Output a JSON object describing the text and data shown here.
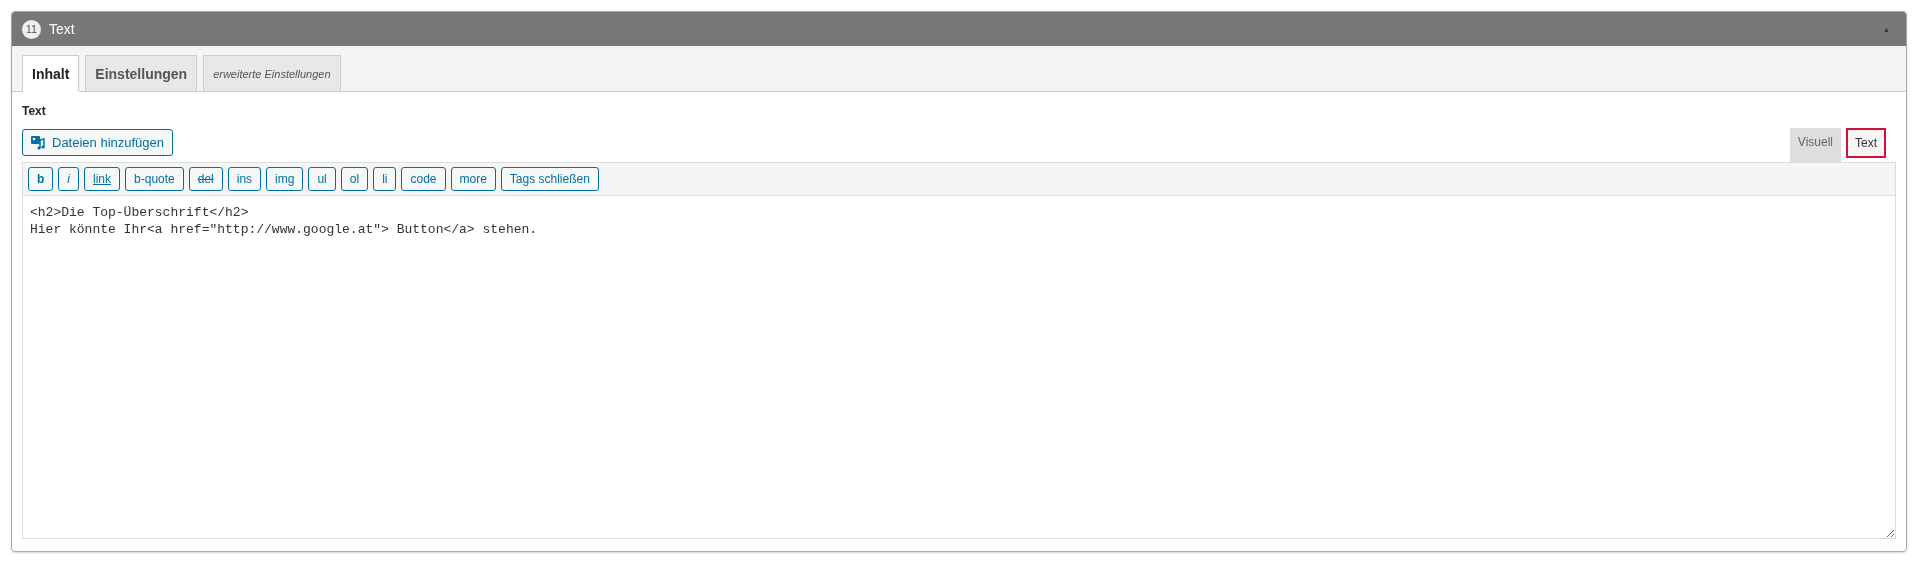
{
  "panel": {
    "number": "11",
    "title": "Text",
    "collapse_icon": "▲"
  },
  "tabs": [
    {
      "label": "Inhalt",
      "selected": true,
      "kind": "normal"
    },
    {
      "label": "Einstellungen",
      "selected": false,
      "kind": "normal"
    },
    {
      "label": "erweiterte Einstellungen",
      "selected": false,
      "kind": "italic"
    }
  ],
  "field_label": "Text",
  "add_media_button": "Dateien hinzufügen",
  "editor_tabs": [
    {
      "label": "Visuell",
      "selected": false,
      "highlighted": false
    },
    {
      "label": "Text",
      "selected": true,
      "highlighted": true
    }
  ],
  "toolbar": [
    {
      "label": "b",
      "kind": "bold"
    },
    {
      "label": "i",
      "kind": "italic"
    },
    {
      "label": "link",
      "kind": "underline"
    },
    {
      "label": "b-quote",
      "kind": "plain"
    },
    {
      "label": "del",
      "kind": "strike"
    },
    {
      "label": "ins",
      "kind": "plain"
    },
    {
      "label": "img",
      "kind": "plain"
    },
    {
      "label": "ul",
      "kind": "plain"
    },
    {
      "label": "ol",
      "kind": "plain"
    },
    {
      "label": "li",
      "kind": "plain"
    },
    {
      "label": "code",
      "kind": "plain"
    },
    {
      "label": "more",
      "kind": "plain"
    },
    {
      "label": "Tags schließen",
      "kind": "plain"
    }
  ],
  "content": "<h2>Die Top-Überschrift</h2>\nHier könnte Ihr<a href=\"http://www.google.at\"> Button</a> stehen."
}
